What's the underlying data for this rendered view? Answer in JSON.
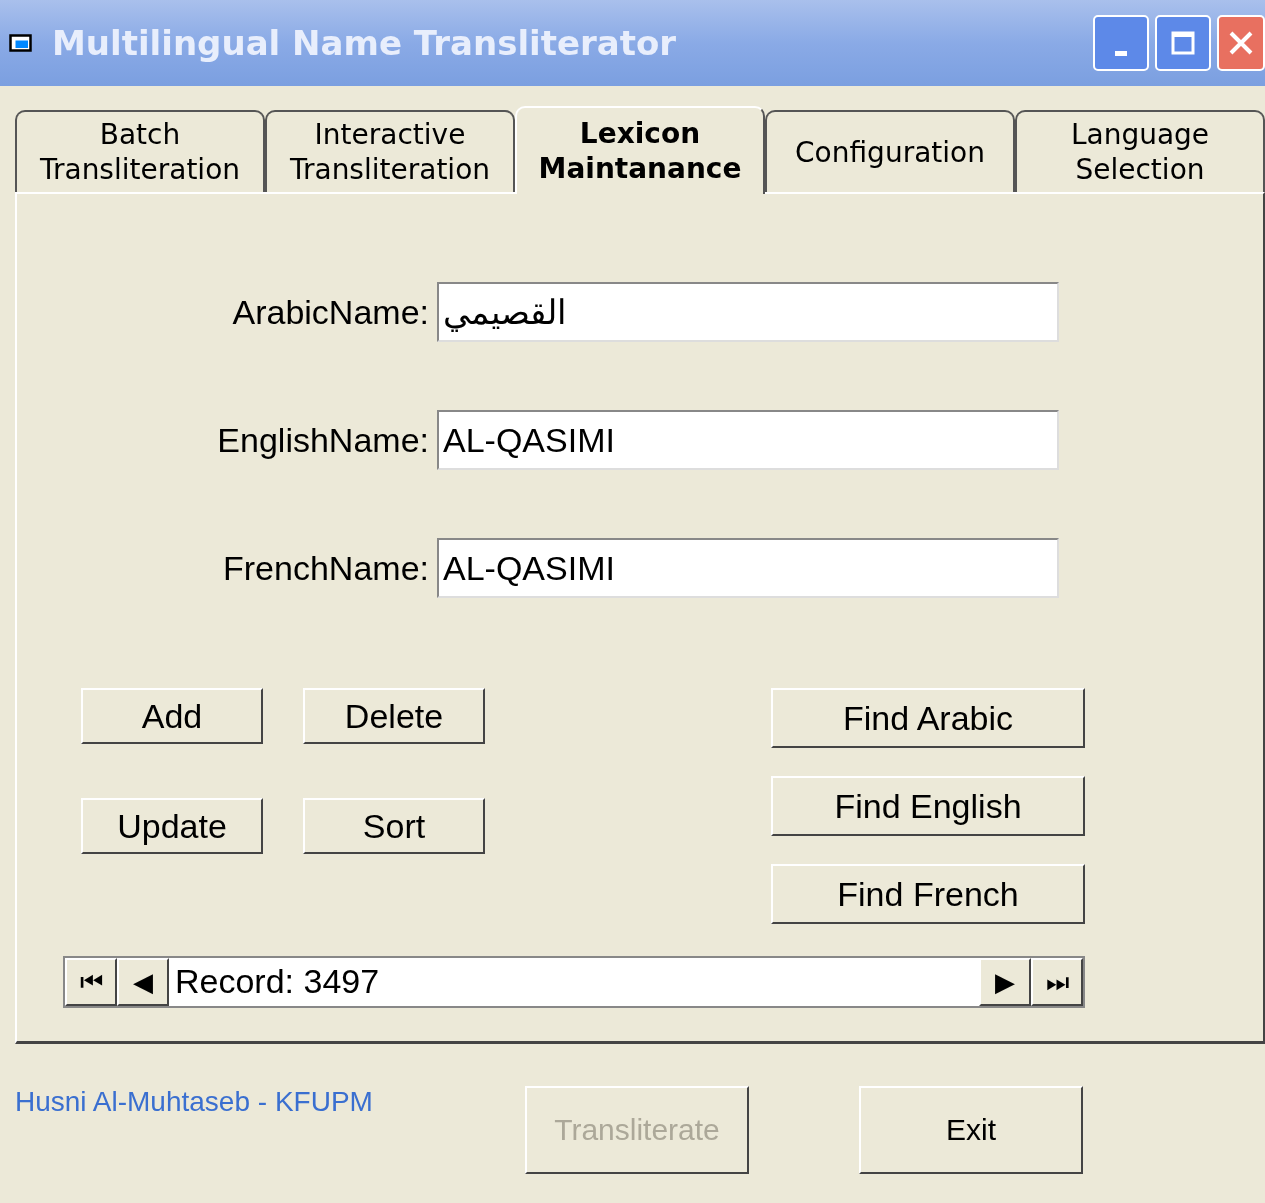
{
  "window": {
    "title": "Multilingual Name Transliterator"
  },
  "tabs": [
    {
      "label": "Batch Transliteration",
      "selected": false
    },
    {
      "label": "Interactive Transliteration",
      "selected": false
    },
    {
      "label": "Lexicon Maintanance",
      "selected": true
    },
    {
      "label": "Configuration",
      "selected": false
    },
    {
      "label": "Language Selection",
      "selected": false
    }
  ],
  "fields": [
    {
      "label": "ArabicName:",
      "value": "القصيمي"
    },
    {
      "label": "EnglishName:",
      "value": "AL-QASIMI"
    },
    {
      "label": "FrenchName:",
      "value": "AL-QASIMI"
    }
  ],
  "edit_buttons": [
    "Add",
    "Delete",
    "Update",
    "Sort"
  ],
  "find_buttons": [
    "Find Arabic",
    "Find English",
    "Find French"
  ],
  "navigator": {
    "first": "⏮",
    "prev": "◀",
    "record": "Record: 3497",
    "next": "▶",
    "last": "⏭"
  },
  "footer": {
    "credit": "Husni Al-Muhtaseb - KFUPM",
    "buttons": [
      {
        "label": "Transliterate",
        "disabled": true
      },
      {
        "label": "Exit",
        "disabled": false
      }
    ]
  }
}
